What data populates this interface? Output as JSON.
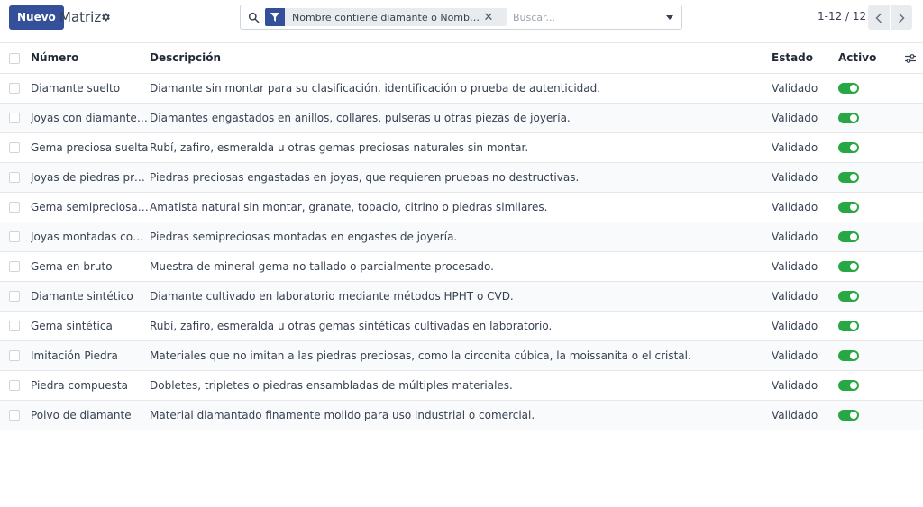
{
  "control_panel": {
    "new_button": "Nuevo",
    "title": "Matriz",
    "gear_icon": "gear-icon"
  },
  "search": {
    "facet_label": "Nombre contiene diamante o Nombre co…",
    "placeholder": "Buscar...",
    "facet_icon": "filter-icon"
  },
  "pager": {
    "value": "1-12 / 12"
  },
  "columns": {
    "number": "Número",
    "description": "Descripción",
    "status": "Estado",
    "active": "Activo"
  },
  "rows": [
    {
      "number": "Diamante suelto",
      "description": "Diamante sin montar para su clasificación, identificación o prueba de autenticidad.",
      "status": "Validado",
      "active": true
    },
    {
      "number": "Joyas con diamantes …",
      "description": "Diamantes engastados en anillos, collares, pulseras u otras piezas de joyería.",
      "status": "Validado",
      "active": true
    },
    {
      "number": "Gema preciosa suelta",
      "description": "Rubí, zafiro, esmeralda u otras gemas preciosas naturales sin montar.",
      "status": "Validado",
      "active": true
    },
    {
      "number": "Joyas de piedras pre…",
      "description": "Piedras preciosas engastadas en joyas, que requieren pruebas no destructivas.",
      "status": "Validado",
      "active": true
    },
    {
      "number": "Gema semipreciosa s…",
      "description": "Amatista natural sin montar, granate, topacio, citrino o piedras similares.",
      "status": "Validado",
      "active": true
    },
    {
      "number": "Joyas montadas con …",
      "description": "Piedras semipreciosas montadas en engastes de joyería.",
      "status": "Validado",
      "active": true
    },
    {
      "number": "Gema en bruto",
      "description": "Muestra de mineral gema no tallado o parcialmente procesado.",
      "status": "Validado",
      "active": true
    },
    {
      "number": "Diamante sintético",
      "description": "Diamante cultivado en laboratorio mediante métodos HPHT o CVD.",
      "status": "Validado",
      "active": true
    },
    {
      "number": "Gema sintética",
      "description": "Rubí, zafiro, esmeralda u otras gemas sintéticas cultivadas en laboratorio.",
      "status": "Validado",
      "active": true
    },
    {
      "number": "Imitación Piedra",
      "description": "Materiales que no imitan a las piedras preciosas, como la circonita cúbica, la moissanita o el cristal.",
      "status": "Validado",
      "active": true
    },
    {
      "number": "Piedra compuesta",
      "description": "Dobletes, tripletes o piedras ensambladas de múltiples materiales.",
      "status": "Validado",
      "active": true
    },
    {
      "number": "Polvo de diamante",
      "description": "Material diamantado finamente molido para uso industrial o comercial.",
      "status": "Validado",
      "active": true
    }
  ],
  "colors": {
    "primary": "#35509a",
    "toggle_on": "#28a745"
  }
}
